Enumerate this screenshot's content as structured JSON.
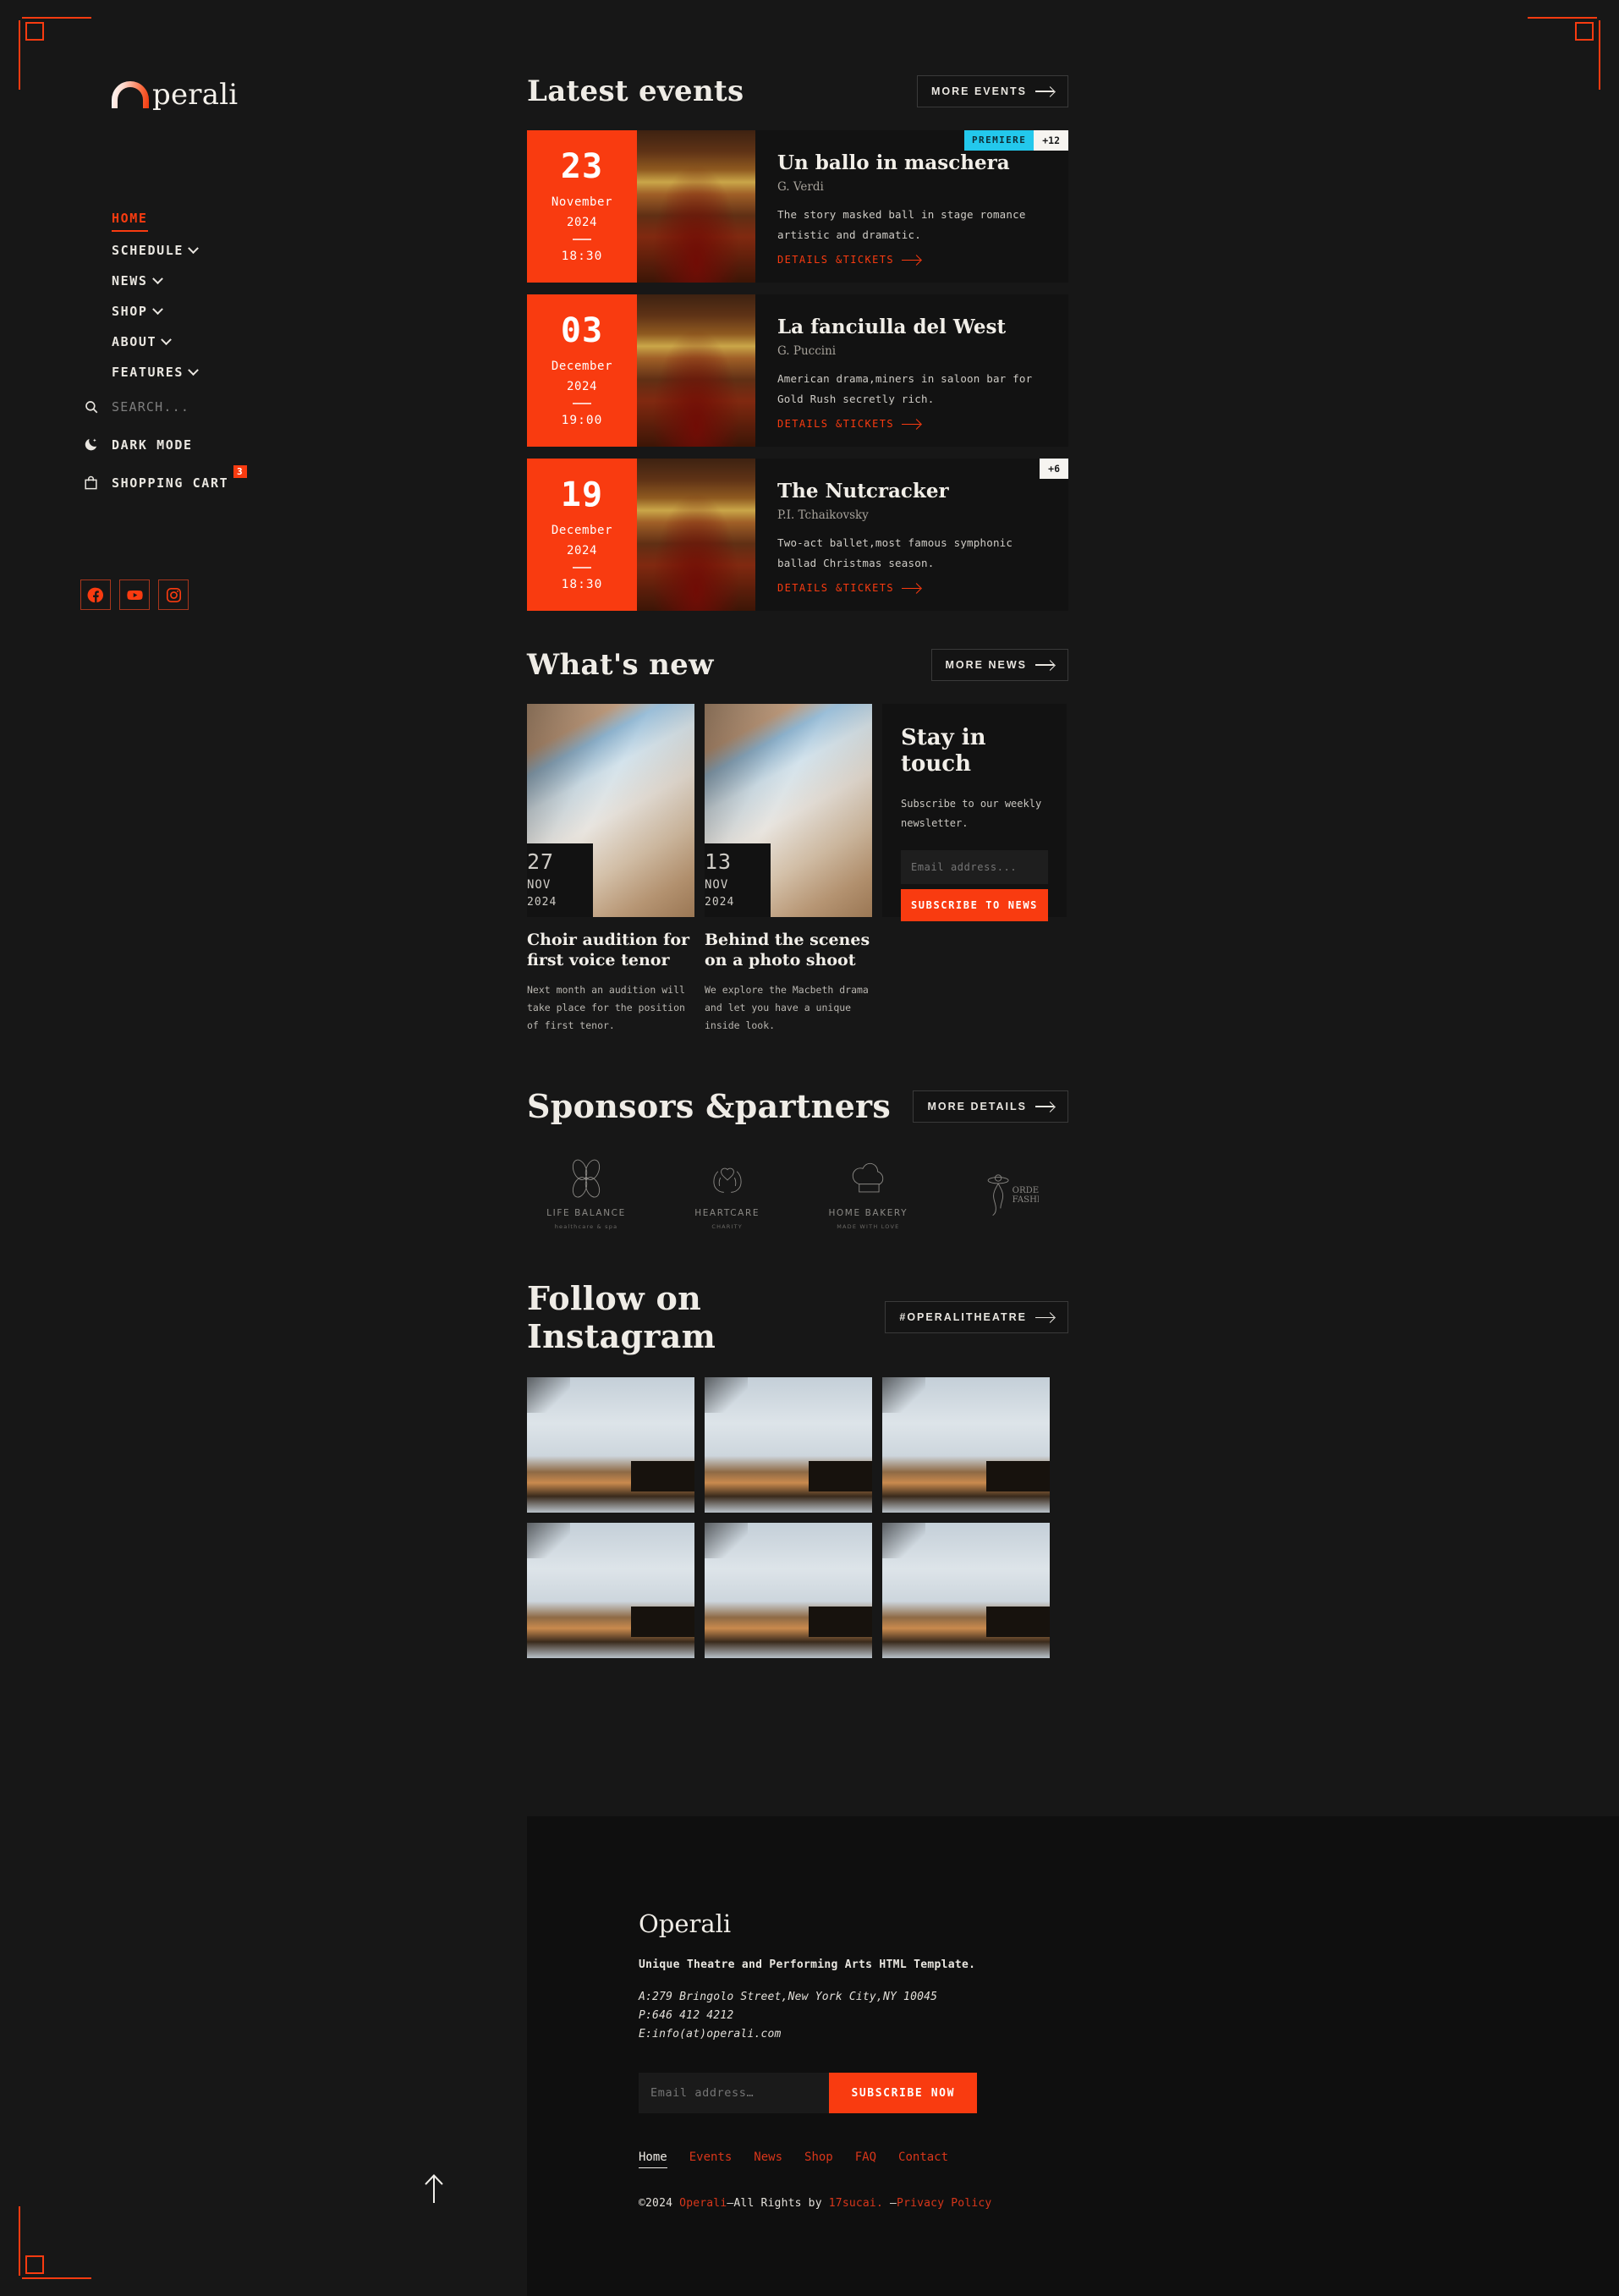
{
  "brand": {
    "logo_text": "perali",
    "logo_icon": "arch-icon"
  },
  "sidebar": {
    "nav": [
      {
        "label": "HOME",
        "active": true,
        "caret": false
      },
      {
        "label": "SCHEDULE",
        "active": false,
        "caret": true
      },
      {
        "label": "NEWS",
        "active": false,
        "caret": true
      },
      {
        "label": "SHOP",
        "active": false,
        "caret": true
      },
      {
        "label": "ABOUT",
        "active": false,
        "caret": true
      },
      {
        "label": "FEATURES",
        "active": false,
        "caret": true
      }
    ],
    "search": {
      "icon": "search-icon",
      "placeholder": "SEARCH..."
    },
    "dark_mode": {
      "icon": "moon-icon",
      "label": "DARK MODE"
    },
    "cart": {
      "icon": "shopping-bag-icon",
      "label": "SHOPPING CART",
      "count": "3"
    },
    "socials": [
      {
        "name": "facebook-icon"
      },
      {
        "name": "youtube-icon"
      },
      {
        "name": "instagram-icon"
      }
    ]
  },
  "events_section": {
    "title": "Latest events",
    "more_label": "MORE EVENTS",
    "items": [
      {
        "day": "23",
        "month": "November",
        "year": "2024",
        "time": "18:30",
        "title": "Un ballo in maschera",
        "composer": "G. Verdi",
        "desc": "The story masked ball in stage romance artistic and dramatic.",
        "link": "DETAILS &TICKETS",
        "badge_premiere": "PREMIERE",
        "badge_more": "+12"
      },
      {
        "day": "03",
        "month": "December",
        "year": "2024",
        "time": "19:00",
        "title": "La fanciulla del West",
        "composer": "G. Puccini",
        "desc": "American drama,miners in saloon bar for Gold Rush secretly rich.",
        "link": "DETAILS &TICKETS",
        "badge_premiere": "",
        "badge_more": ""
      },
      {
        "day": "19",
        "month": "December",
        "year": "2024",
        "time": "18:30",
        "title": "The Nutcracker",
        "composer": "P.I. Tchaikovsky",
        "desc": "Two-act ballet,most famous symphonic ballad Christmas season.",
        "link": "DETAILS &TICKETS",
        "badge_premiere": "",
        "badge_more": "+6"
      }
    ]
  },
  "news_section": {
    "title": "What's new",
    "more_label": "MORE NEWS",
    "items": [
      {
        "day": "27",
        "month": "NOV",
        "year": "2024",
        "title": "Choir audition for first voice tenor",
        "desc": "Next month an audition will take place for the position of first tenor."
      },
      {
        "day": "13",
        "month": "NOV",
        "year": "2024",
        "title": "Behind the scenes on a photo shoot",
        "desc": "We explore the Macbeth drama and let you have a unique inside look."
      }
    ],
    "newsletter": {
      "title": "Stay in touch",
      "subtitle": "Subscribe to our weekly newsletter.",
      "placeholder": "Email address...",
      "button": "SUBSCRIBE TO NEWS"
    }
  },
  "sponsors_section": {
    "title": "Sponsors &partners",
    "more_label": "MORE DETAILS",
    "items": [
      {
        "icon": "butterfly-icon",
        "name": "LIFE BALANCE",
        "sub": "healthcare & spa"
      },
      {
        "icon": "heart-hands-icon",
        "name": "HEARTCARE",
        "sub": "CHARITY"
      },
      {
        "icon": "chef-hat-icon",
        "name": "HOME BAKERY",
        "sub": "MADE WITH LOVE"
      },
      {
        "icon": "fashion-figure-icon",
        "name": "ORDERLY FASHION",
        "sub": ""
      }
    ]
  },
  "instagram_section": {
    "title": "Follow on Instagram",
    "more_label": "#OPERALITHEATRE",
    "tiles": 6
  },
  "footer": {
    "logo": "Operali",
    "tagline": "Unique Theatre and Performing Arts HTML Template.",
    "address": "A:279 Bringolo Street,New York City,NY 10045",
    "phone": "P:646 412 4212",
    "email": "E:info(at)operali.com",
    "placeholder": "Email address…",
    "button": "SUBSCRIBE NOW",
    "nav": [
      "Home",
      "Events",
      "News",
      "Shop",
      "FAQ",
      "Contact"
    ],
    "copyright_prefix": "©2024 ",
    "copyright_brand": "Operali",
    "copyright_mid": "—All Rights by ",
    "copyright_author": "17sucai.",
    "copyright_dash": " —",
    "copyright_privacy": "Privacy Policy"
  },
  "scroll_top": {
    "icon": "arrow-up-icon"
  },
  "colors": {
    "accent": "#f93b10",
    "cyan": "#23c8ec",
    "bg": "#171717",
    "panel": "#0f0f0f"
  }
}
